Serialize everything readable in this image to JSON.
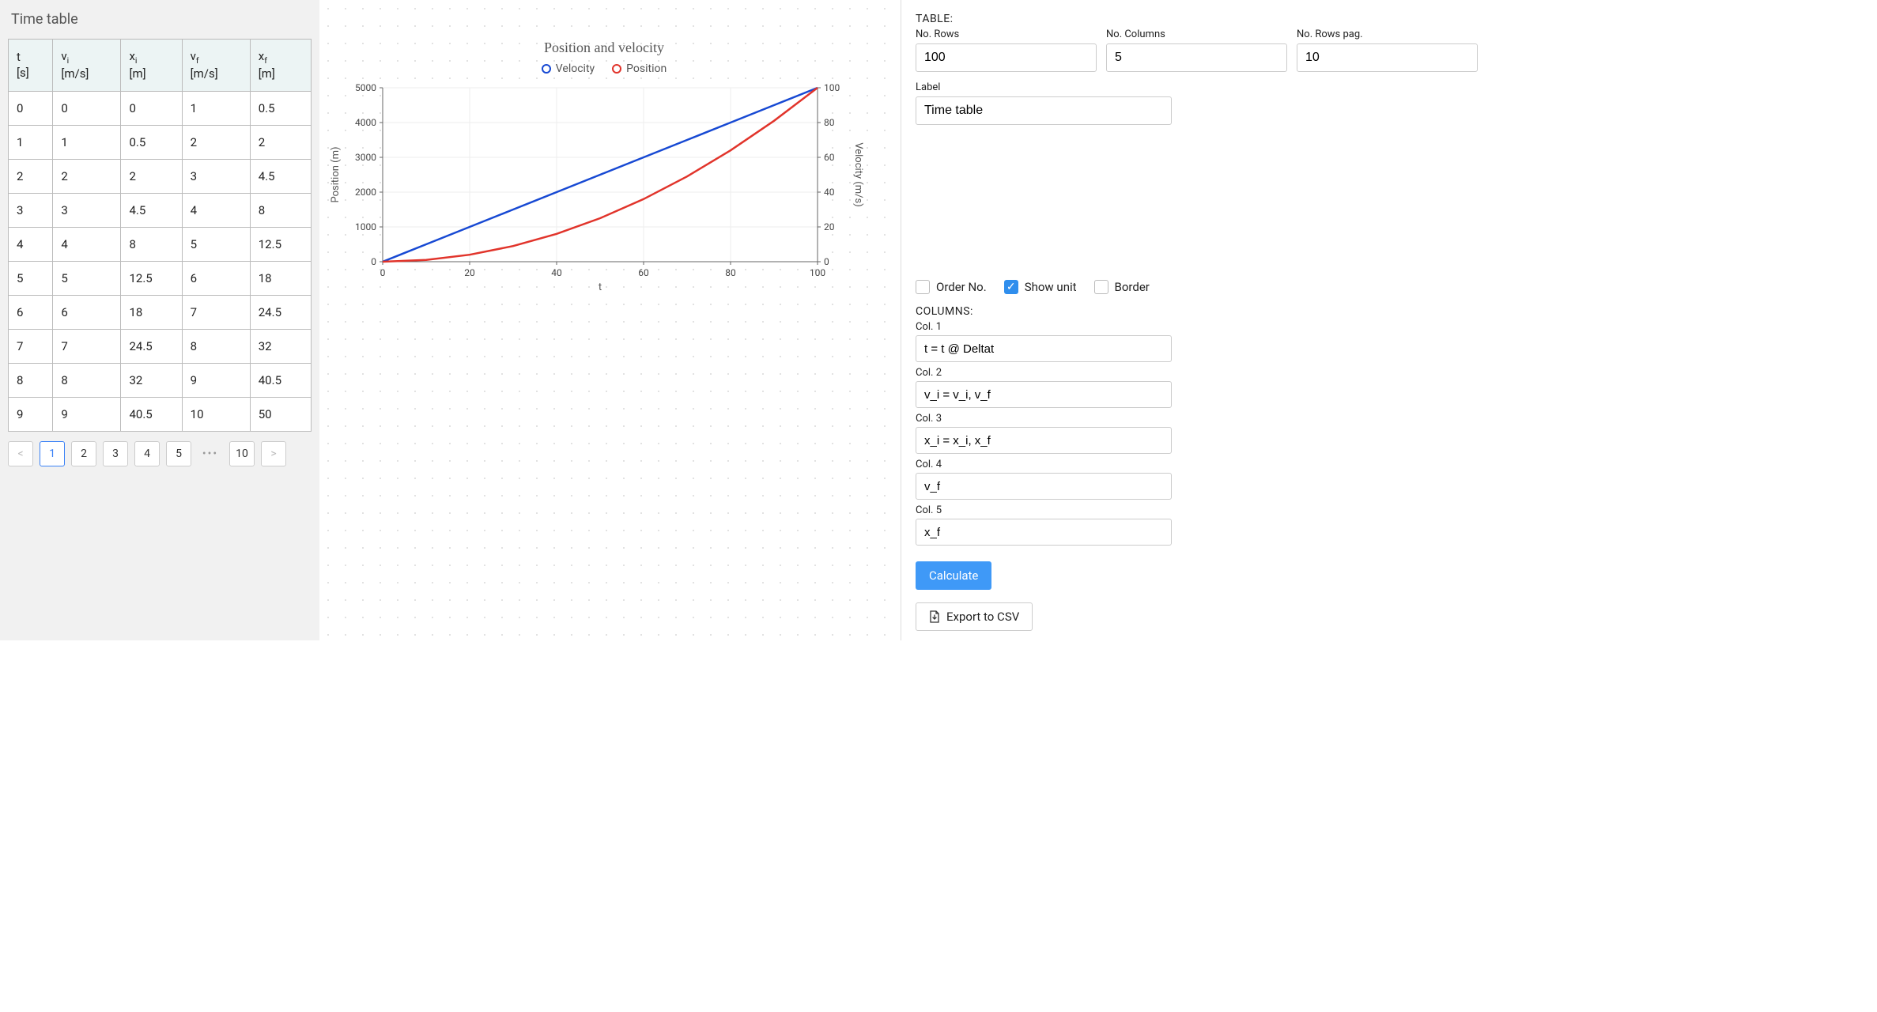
{
  "table": {
    "title": "Time table",
    "columns": [
      {
        "sym": "t",
        "unit": "[s]"
      },
      {
        "sym_html": "v<sub>i</sub>",
        "unit": "[m/s]"
      },
      {
        "sym_html": "x<sub>i</sub>",
        "unit": "[m]"
      },
      {
        "sym_html": "v<sub>f</sub>",
        "unit": "[m/s]"
      },
      {
        "sym_html": "x<sub>f</sub>",
        "unit": "[m]"
      }
    ],
    "rows": [
      [
        "0",
        "0",
        "0",
        "1",
        "0.5"
      ],
      [
        "1",
        "1",
        "0.5",
        "2",
        "2"
      ],
      [
        "2",
        "2",
        "2",
        "3",
        "4.5"
      ],
      [
        "3",
        "3",
        "4.5",
        "4",
        "8"
      ],
      [
        "4",
        "4",
        "8",
        "5",
        "12.5"
      ],
      [
        "5",
        "5",
        "12.5",
        "6",
        "18"
      ],
      [
        "6",
        "6",
        "18",
        "7",
        "24.5"
      ],
      [
        "7",
        "7",
        "24.5",
        "8",
        "32"
      ],
      [
        "8",
        "8",
        "32",
        "9",
        "40.5"
      ],
      [
        "9",
        "9",
        "40.5",
        "10",
        "50"
      ]
    ]
  },
  "pager": {
    "prev": "<",
    "pages": [
      "1",
      "2",
      "3",
      "4",
      "5"
    ],
    "ellipsis": "•••",
    "last": "10",
    "next": ">",
    "current": "1"
  },
  "chart_data": {
    "type": "line",
    "title": "Position and velocity",
    "xlabel": "t",
    "x": [
      0,
      10,
      20,
      30,
      40,
      50,
      60,
      70,
      80,
      90,
      100
    ],
    "x_ticks": [
      0,
      20,
      40,
      60,
      80,
      100
    ],
    "series": [
      {
        "name": "Velocity",
        "color": "#1749d3",
        "axis": "right",
        "ylabel": "Velocity (m/s)",
        "ylim": [
          0,
          100
        ],
        "ticks": [
          0,
          20,
          40,
          60,
          80,
          100
        ],
        "values": [
          0,
          10,
          20,
          30,
          40,
          50,
          60,
          70,
          80,
          90,
          100
        ]
      },
      {
        "name": "Position",
        "color": "#e1342b",
        "axis": "left",
        "ylabel": "Position (m)",
        "ylim": [
          0,
          5000
        ],
        "ticks": [
          0,
          1000,
          2000,
          3000,
          4000,
          5000
        ],
        "values": [
          0,
          50,
          200,
          450,
          800,
          1250,
          1800,
          2450,
          3200,
          4050,
          5000
        ]
      }
    ]
  },
  "controls": {
    "section_table": "TABLE:",
    "no_rows_label": "No. Rows",
    "no_rows": "100",
    "no_cols_label": "No. Columns",
    "no_cols": "5",
    "no_rows_pag_label": "No. Rows pag.",
    "no_rows_pag": "10",
    "label_label": "Label",
    "label_value": "Time table",
    "check_order": {
      "label": "Order No.",
      "checked": false
    },
    "check_unit": {
      "label": "Show unit",
      "checked": true
    },
    "check_border": {
      "label": "Border",
      "checked": false
    },
    "section_cols": "COLUMNS:",
    "cols": [
      {
        "label": "Col. 1",
        "value": "t = t @ Deltat"
      },
      {
        "label": "Col. 2",
        "value": "v_i = v_i, v_f"
      },
      {
        "label": "Col. 3",
        "value": "x_i = x_i, x_f"
      },
      {
        "label": "Col. 4",
        "value": "v_f"
      },
      {
        "label": "Col. 5",
        "value": "x_f"
      }
    ],
    "calculate": "Calculate",
    "export": "Export to CSV"
  }
}
